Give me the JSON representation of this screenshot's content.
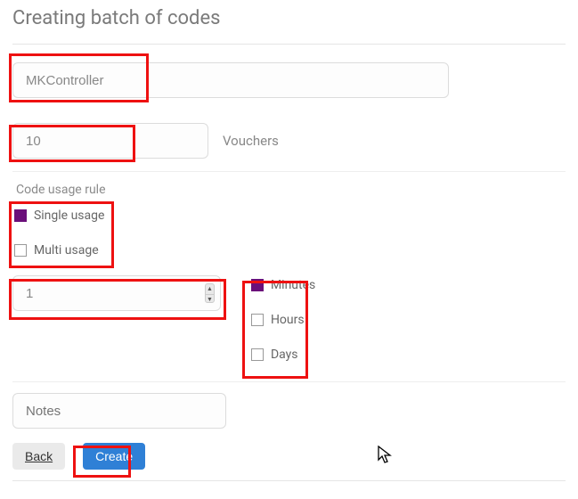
{
  "title": "Creating batch of codes",
  "name_field": {
    "value": "MKController"
  },
  "qty_field": {
    "value": "10",
    "suffix": "Vouchers"
  },
  "usage": {
    "section_label": "Code usage rule",
    "options": [
      {
        "label": "Single usage",
        "checked": true
      },
      {
        "label": "Multi usage",
        "checked": false
      }
    ]
  },
  "duration_value": "1",
  "units": [
    {
      "label": "Minutes",
      "checked": true
    },
    {
      "label": "Hours",
      "checked": false
    },
    {
      "label": "Days",
      "checked": false
    }
  ],
  "notes_placeholder": "Notes",
  "buttons": {
    "back": "Back",
    "create": "Create"
  }
}
